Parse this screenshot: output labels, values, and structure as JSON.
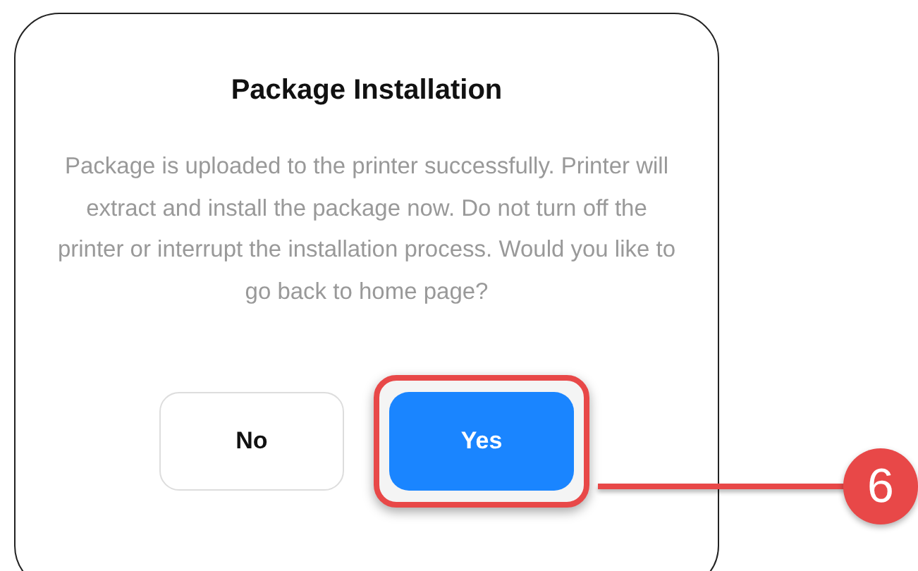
{
  "dialog": {
    "title": "Package Installation",
    "message": "Package is uploaded to the printer successfully. Printer will extract and install the package now. Do not turn off the printer or interrupt the installation process. Would you like to go back to home page?",
    "buttons": [
      {
        "label": "No",
        "kind": "secondary",
        "highlighted": false
      },
      {
        "label": "Yes",
        "kind": "primary",
        "highlighted": true
      }
    ]
  },
  "callout": {
    "label": "6"
  }
}
